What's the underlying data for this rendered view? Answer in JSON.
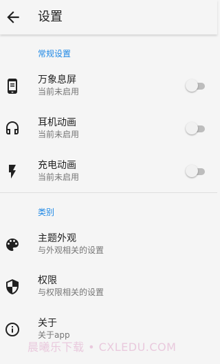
{
  "app_bar": {
    "title": "设置",
    "back_icon": "arrow-back-icon"
  },
  "sections": [
    {
      "header": "常规设置",
      "items": [
        {
          "icon": "phone-screen-icon",
          "title": "万象息屏",
          "subtitle": "当前未启用",
          "toggle": false
        },
        {
          "icon": "headphones-icon",
          "title": "耳机动画",
          "subtitle": "当前未启用",
          "toggle": false
        },
        {
          "icon": "flash-icon",
          "title": "充电动画",
          "subtitle": "当前未启用",
          "toggle": false
        }
      ]
    },
    {
      "header": "类别",
      "items": [
        {
          "icon": "palette-icon",
          "title": "主题外观",
          "subtitle": "与外观相关的设置"
        },
        {
          "icon": "shield-icon",
          "title": "权限",
          "subtitle": "与权限相关的设置"
        },
        {
          "icon": "info-icon",
          "title": "关于",
          "subtitle": "关于app"
        }
      ]
    }
  ],
  "watermark": "晨曦乐下载 • CXLEDU.COM",
  "colors": {
    "accent": "#1e88e5",
    "background": "#f5f5f5",
    "switch_track_off": "#bdbdbd",
    "switch_thumb_off": "#f1f1f1"
  }
}
